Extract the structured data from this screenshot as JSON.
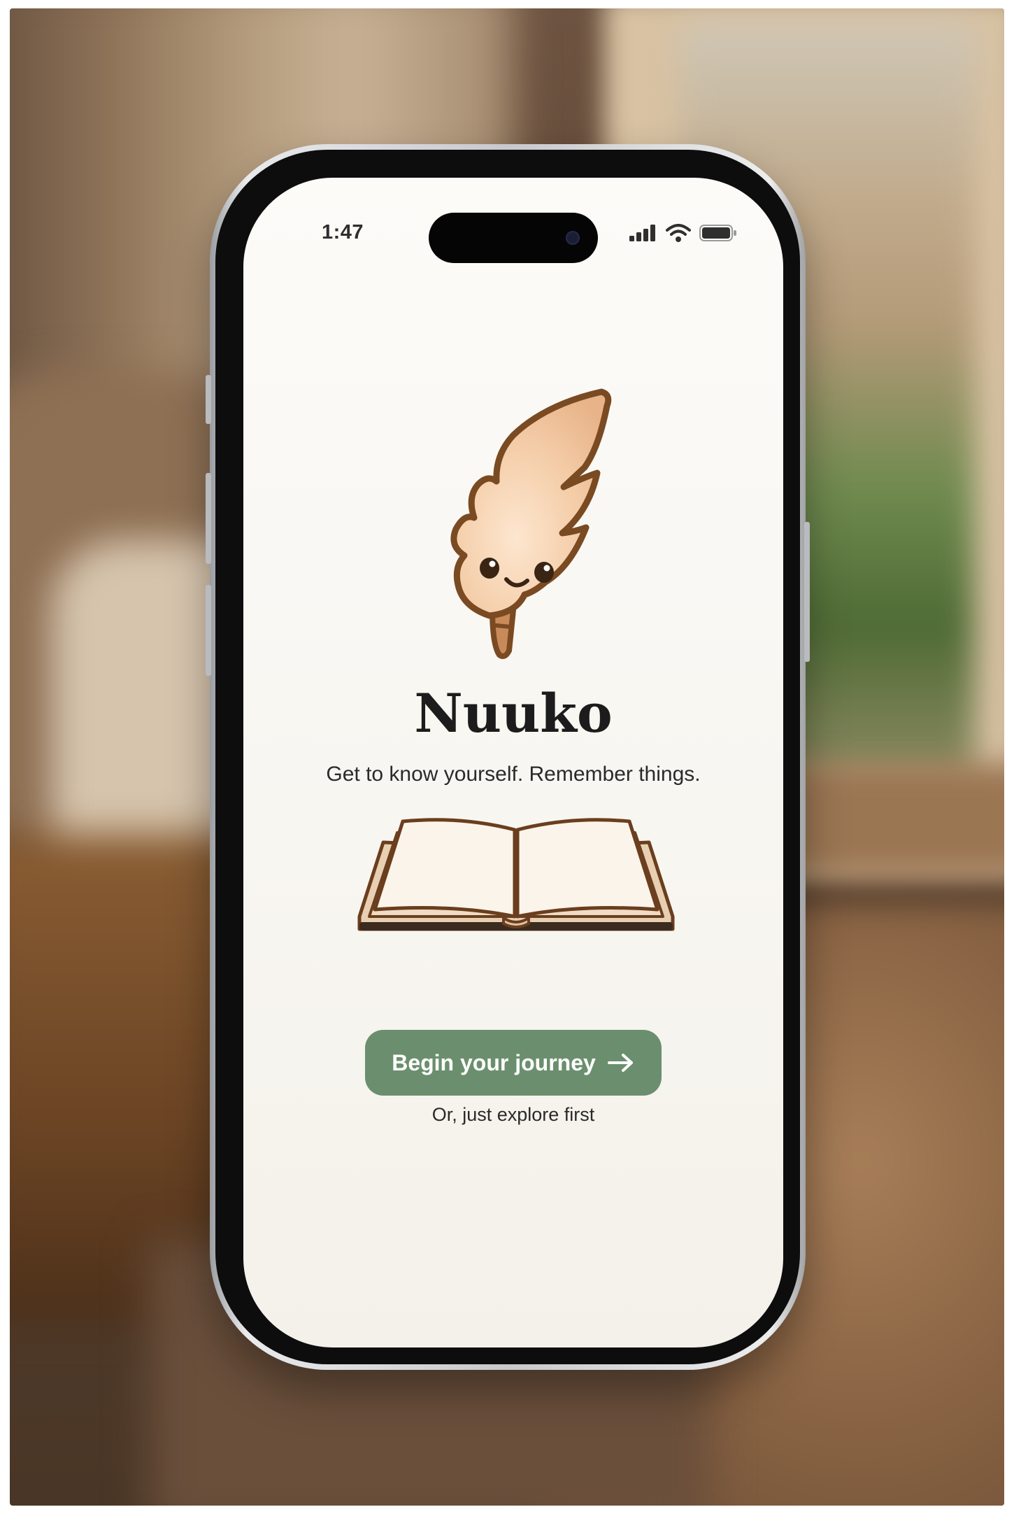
{
  "status_bar": {
    "time": "1:47",
    "icons": [
      "signal-icon",
      "wifi-icon",
      "battery-icon"
    ]
  },
  "app": {
    "name": "Nuuko",
    "tagline": "Get to know yourself. Remember things.",
    "mascot": "feather-mascot",
    "illustration": "open-book-icon"
  },
  "actions": {
    "primary_label": "Begin your journey",
    "primary_icon": "arrow-right-icon",
    "secondary_label": "Or, just explore first"
  },
  "colors": {
    "accent": "#6b8f6e",
    "background": "#f8f6f1",
    "mascot_outline": "#7a4a22",
    "mascot_fill": "#f2c9a2"
  }
}
